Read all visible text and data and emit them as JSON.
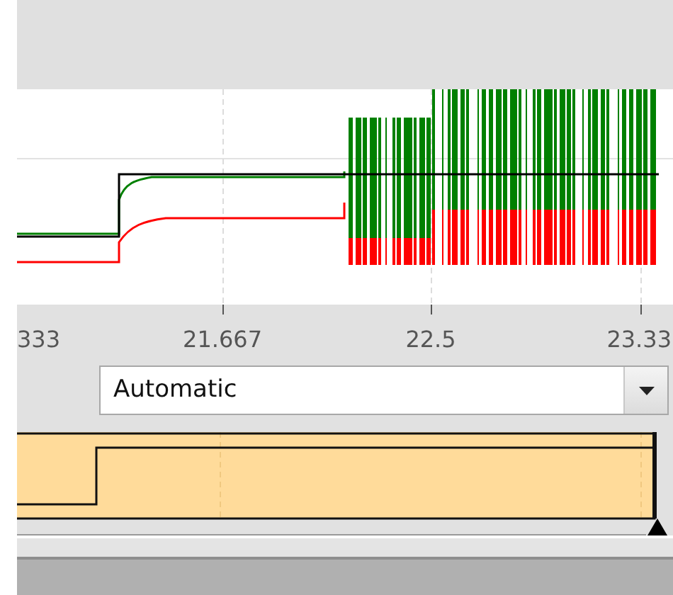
{
  "chart": {
    "x_labels": [
      "333",
      "21.667",
      "22.5",
      "23.33"
    ]
  },
  "mode_dropdown": {
    "value": "Automatic"
  }
}
